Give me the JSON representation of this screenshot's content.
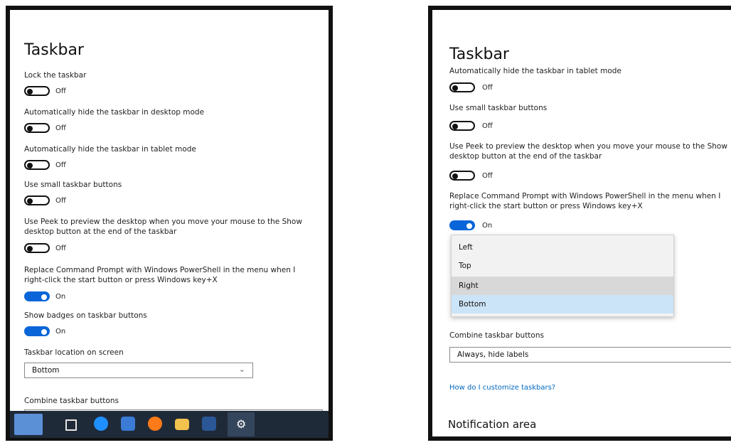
{
  "left": {
    "title": "Taskbar",
    "settings": [
      {
        "label": "Lock the taskbar",
        "state": "Off"
      },
      {
        "label": "Automatically hide the taskbar in desktop mode",
        "state": "Off"
      },
      {
        "label": "Automatically hide the taskbar in tablet mode",
        "state": "Off"
      },
      {
        "label": "Use small taskbar buttons",
        "state": "Off"
      },
      {
        "label": "Use Peek to preview the desktop when you move your mouse to the Show desktop button at the end of the taskbar",
        "state": "Off"
      },
      {
        "label": "Replace Command Prompt with Windows PowerShell in the menu when I right-click the start button or press Windows key+X",
        "state": "On"
      },
      {
        "label": "Show badges on taskbar buttons",
        "state": "On"
      }
    ],
    "location_label": "Taskbar location on screen",
    "location_value": "Bottom",
    "combine_label": "Combine taskbar buttons",
    "taskbar_icons": [
      "user-avatar-icon",
      "task-view-icon",
      "edge-icon",
      "store-icon",
      "firefox-icon",
      "file-explorer-icon",
      "word-icon",
      "settings-icon"
    ]
  },
  "right": {
    "title": "Taskbar",
    "settings": [
      {
        "label": "Automatically hide the taskbar in tablet mode",
        "state": "Off"
      },
      {
        "label": "Use small taskbar buttons",
        "state": "Off"
      },
      {
        "label": "Use Peek to preview the desktop when you move your mouse to the Show desktop button at the end of the taskbar",
        "state": "Off"
      },
      {
        "label": "Replace Command Prompt with Windows PowerShell in the menu when I right-click the start button or press Windows key+X",
        "state": "On"
      }
    ],
    "dropdown_options": [
      "Left",
      "Top",
      "Right",
      "Bottom"
    ],
    "combine_label": "Combine taskbar buttons",
    "combine_value": "Always, hide labels",
    "help_link": "How do I customize taskbars?",
    "notification_title": "Notification area"
  },
  "colors": {
    "accent": "#0a66d8",
    "taskbar_bg": "#1f2a38",
    "link": "#0067c0"
  }
}
